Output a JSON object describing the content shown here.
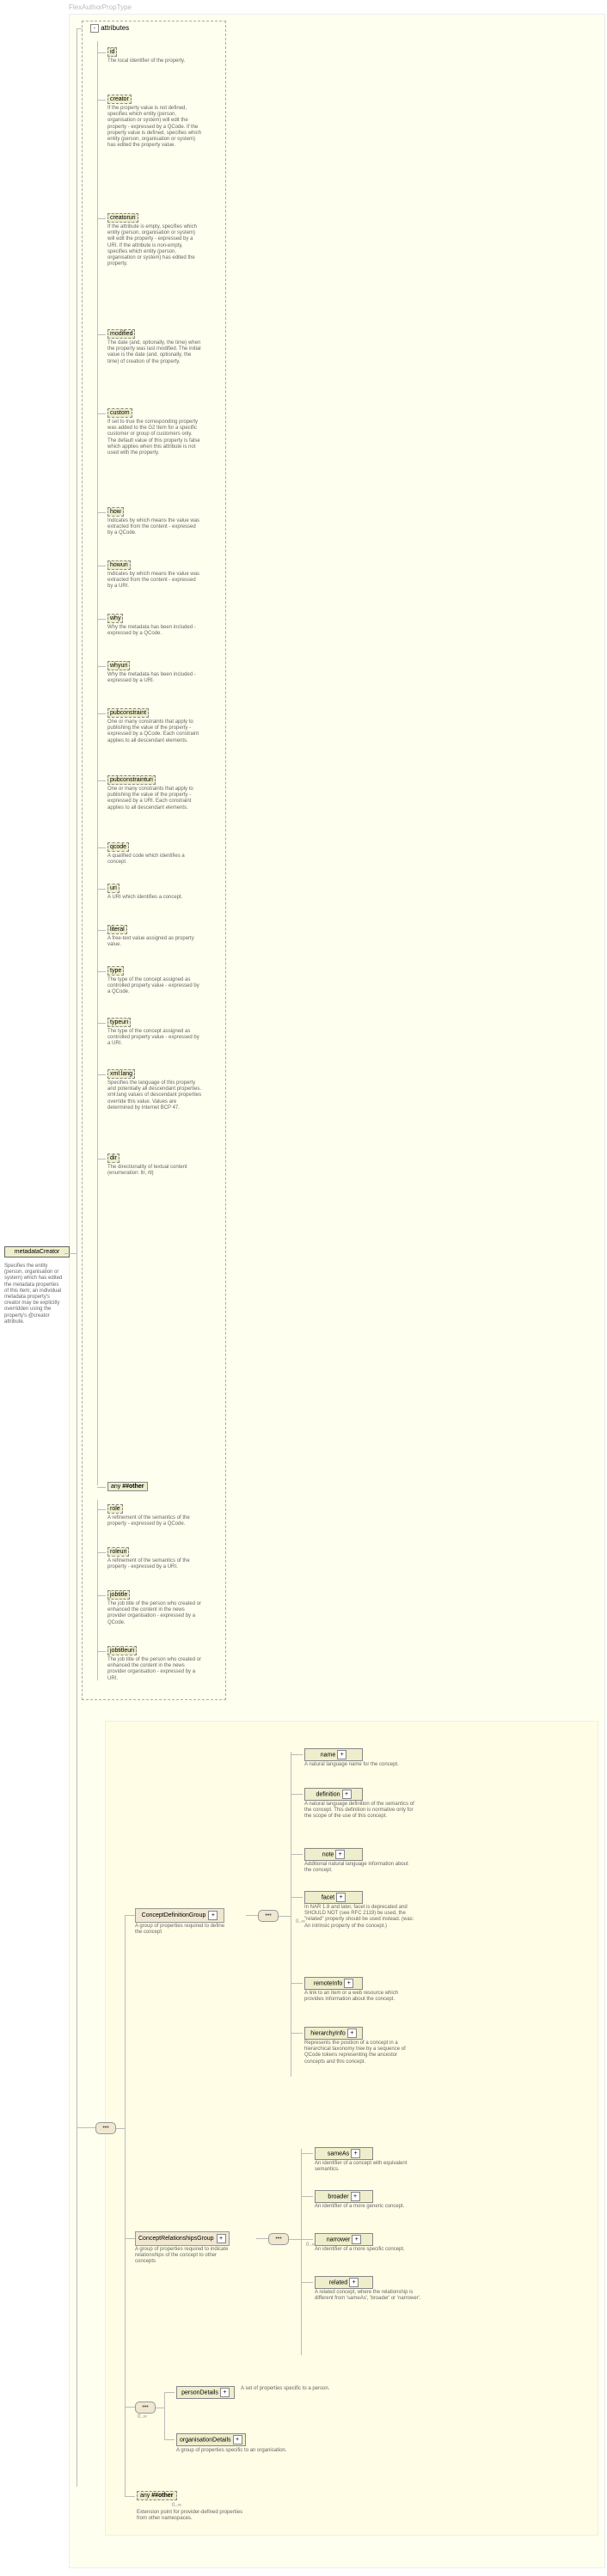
{
  "title": "FlexAuthorPropType",
  "attributesLabel": "attributes",
  "root": {
    "label": "metadataCreator",
    "desc": "Specifies the entity (person, organisation or system) which has edited the metadata properties of this Item; an individual metadata property's creator may be explicitly overridden using the property's @creator attribute."
  },
  "attrs": [
    {
      "n": "id",
      "d": "The local identifier of the property."
    },
    {
      "n": "creator",
      "d": "If the property value is not defined, specifies which entity (person, organisation or system) will edit the property - expressed by a QCode. If the property value is defined, specifies which entity (person, organisation or system) has edited the property value."
    },
    {
      "n": "creatoruri",
      "d": "If the attribute is empty, specifies which entity (person, organisation or system) will edit the property - expressed by a URI. If the attribute is non-empty, specifies which entity (person, organisation or system) has edited the property."
    },
    {
      "n": "modified",
      "d": "The date (and, optionally, the time) when the property was last modified. The initial value is the date (and, optionally, the time) of creation of the property."
    },
    {
      "n": "custom",
      "d": "If set to true the corresponding property was added to the G2 Item for a specific customer or group of customers only. The default value of this property is false which applies when this attribute is not used with the property."
    },
    {
      "n": "how",
      "d": "Indicates by which means the value was extracted from the content - expressed by a QCode."
    },
    {
      "n": "howuri",
      "d": "Indicates by which means the value was extracted from the content - expressed by a URI."
    },
    {
      "n": "why",
      "d": "Why the metadata has been included - expressed by a QCode."
    },
    {
      "n": "whyuri",
      "d": "Why the metadata has been included - expressed by a URI."
    },
    {
      "n": "pubconstraint",
      "d": "One or many constraints that apply to publishing the value of the property - expressed by a QCode. Each constraint applies to all descendant elements."
    },
    {
      "n": "pubconstrainturi",
      "d": "One or many constraints that apply to publishing the value of the property - expressed by a URI. Each constraint applies to all descendant elements."
    },
    {
      "n": "qcode",
      "d": "A qualified code which identifies a concept."
    },
    {
      "n": "uri",
      "d": "A URI which identifies a concept."
    },
    {
      "n": "literal",
      "d": "A free-text value assigned as property value."
    },
    {
      "n": "type",
      "d": "The type of the concept assigned as controlled property value - expressed by a QCode."
    },
    {
      "n": "typeuri",
      "d": "The type of the concept assigned as controlled property value - expressed by a URI."
    },
    {
      "n": "xml:lang",
      "d": "Specifies the language of this property and potentially all descendant properties. xml:lang values of descendant properties override this value. Values are determined by Internet BCP 47."
    },
    {
      "n": "dir",
      "d": "The directionality of textual content (enumeration: ltr, rtl)"
    }
  ],
  "anyAttrLabel": "##other",
  "roleAttrs": [
    {
      "n": "role",
      "d": "A refinement of the semantics of the property - expressed by a QCode."
    },
    {
      "n": "roleuri",
      "d": "A refinement of the semantics of the property - expressed by a URI."
    },
    {
      "n": "jobtitle",
      "d": "The job title of the person who created or enhanced the content in the news provider organisation - expressed by a QCode."
    },
    {
      "n": "jobtitleuri",
      "d": "The job title of the person who created or enhanced the content in the news provider organisation - expressed by a URI."
    }
  ],
  "cdg": {
    "label": "ConceptDefinitionGroup",
    "desc": "A group of properties required to define the concept"
  },
  "cdItems": [
    {
      "n": "name",
      "d": "A natural language name for the concept."
    },
    {
      "n": "definition",
      "d": "A natural language definition of the semantics of the concept. This definition is normative only for the scope of the use of this concept."
    },
    {
      "n": "note",
      "d": "Additional natural language information about the concept."
    },
    {
      "n": "facet",
      "d": "In NAR 1.8 and later, facet is deprecated and SHOULD NOT (see RFC 2119) be used, the \"related\" property should be used instead. (was: An intrinsic property of the concept.)"
    },
    {
      "n": "remoteInfo",
      "d": "A link to an item or a web resource which provides information about the concept."
    },
    {
      "n": "hierarchyInfo",
      "d": "Represents the position of a concept in a hierarchical taxonomy tree by a sequence of QCode tokens representing the ancestor concepts and this concept."
    }
  ],
  "crg": {
    "label": "ConceptRelationshipsGroup",
    "desc": "A group of properties required to indicate relationships of the concept to other concepts"
  },
  "crItems": [
    {
      "n": "sameAs",
      "d": "An identifier of a concept with equivalent semantics."
    },
    {
      "n": "broader",
      "d": "An identifier of a more generic concept."
    },
    {
      "n": "narrower",
      "d": "An identifier of a more specific concept."
    },
    {
      "n": "related",
      "d": "A related concept, where the relationship is different from 'sameAs', 'broader' or 'narrower'."
    }
  ],
  "person": {
    "n": "personDetails",
    "d": "A set of properties specific to a person."
  },
  "org": {
    "n": "organisationDetails",
    "d": "A group of properties specific to an organisation."
  },
  "extAny": {
    "label": "##other",
    "desc": "Extension point for provider-defined properties from other namespaces."
  },
  "occInf": "0..∞",
  "anyPrefix": "any "
}
